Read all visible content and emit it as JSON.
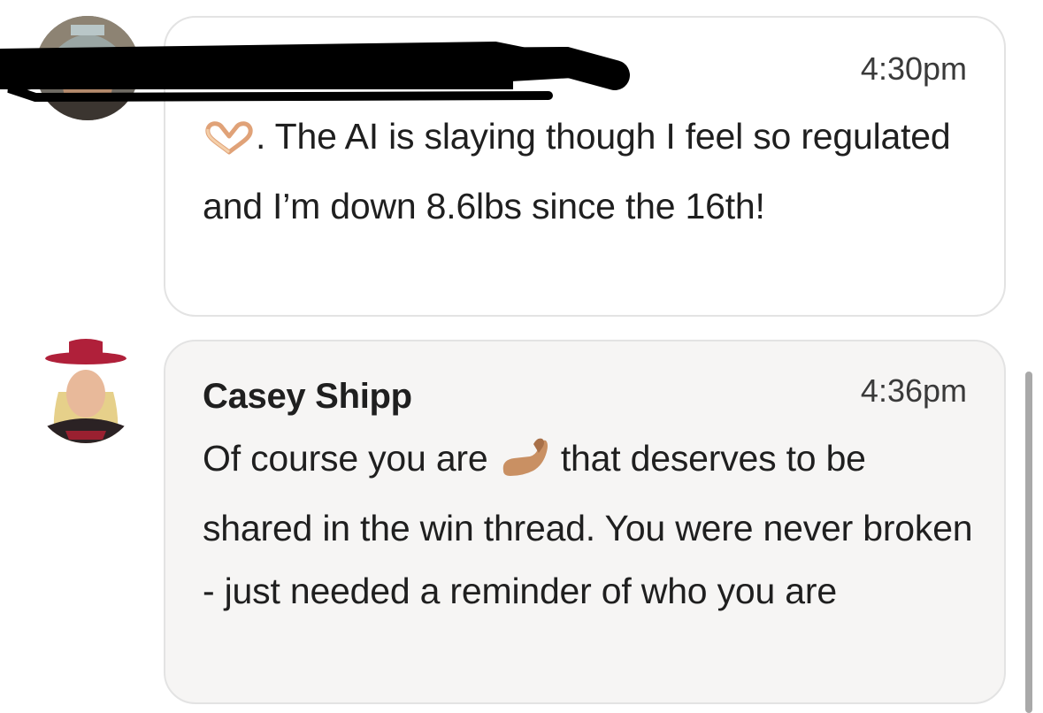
{
  "messages": [
    {
      "author": "",
      "time": "4:30pm",
      "text": ". The AI is slaying though I feel so regulated and I’m down 8.6lbs since the 16th!",
      "leading_icon": "heart-hands-icon",
      "avatar_icon": "user-avatar-cap"
    },
    {
      "author": "Casey Shipp",
      "time": "4:36pm",
      "text_before_icon": "Of course you are ",
      "inline_icon": "pinched-fingers-icon",
      "text_after_icon": " that deserves to be shared in the win thread. You were never broken - just needed a reminder of who you are",
      "avatar_icon": "user-avatar-red-hat"
    }
  ],
  "colors": {
    "bubble_border": "#e3e3e3",
    "bubble_2_bg": "#f6f5f4",
    "text": "#1f1f1f",
    "redaction": "#000000",
    "hat": "#b0203a",
    "emoji_skin": "#c99063"
  }
}
